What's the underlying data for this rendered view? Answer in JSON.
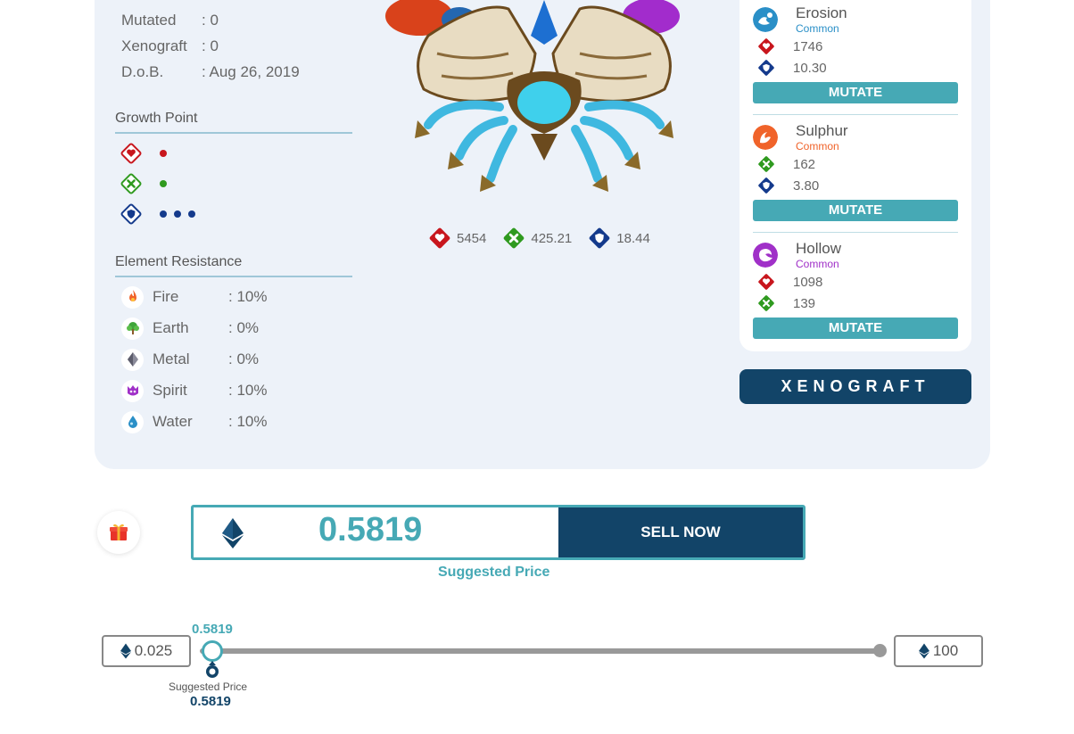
{
  "info": {
    "mutated": {
      "label": "Mutated",
      "value": ": 0"
    },
    "xenograft": {
      "label": "Xenograft",
      "value": ": 0"
    },
    "dob": {
      "label": "D.o.B.",
      "value": ": Aug 26, 2019"
    }
  },
  "growth_point": {
    "title": "Growth Point",
    "rows": [
      {
        "icon": "heart-icon",
        "color": "#c8161d",
        "dots": 1
      },
      {
        "icon": "attack-icon",
        "color": "#2f9a1f",
        "dots": 1
      },
      {
        "icon": "shield-icon",
        "color": "#143a8c",
        "dots": 3
      }
    ]
  },
  "element_resistance": {
    "title": "Element Resistance",
    "items": [
      {
        "name": "Fire",
        "value": ": 10%",
        "icon": "fire-icon"
      },
      {
        "name": "Earth",
        "value": ": 0%",
        "icon": "earth-icon"
      },
      {
        "name": "Metal",
        "value": ": 0%",
        "icon": "metal-icon"
      },
      {
        "name": "Spirit",
        "value": ": 10%",
        "icon": "spirit-icon"
      },
      {
        "name": "Water",
        "value": ": 10%",
        "icon": "water-icon"
      }
    ]
  },
  "stats": {
    "hp": "5454",
    "attack": "425.21",
    "defense": "18.44"
  },
  "mutations": [
    {
      "name": "Erosion",
      "rarity": "Common",
      "rarity_color": "#2a8fc7",
      "icon_color": "#2a8fc7",
      "stats": [
        {
          "type": "hp",
          "value": "1746"
        },
        {
          "type": "defense",
          "value": "10.30"
        }
      ],
      "button": "MUTATE"
    },
    {
      "name": "Sulphur",
      "rarity": "Common",
      "rarity_color": "#f0632a",
      "icon_color": "#f0632a",
      "stats": [
        {
          "type": "attack",
          "value": "162"
        },
        {
          "type": "defense",
          "value": "3.80"
        }
      ],
      "button": "MUTATE"
    },
    {
      "name": "Hollow",
      "rarity": "Common",
      "rarity_color": "#a030c8",
      "icon_color": "#a030c8",
      "stats": [
        {
          "type": "hp",
          "value": "1098"
        },
        {
          "type": "attack",
          "value": "139"
        }
      ],
      "button": "MUTATE"
    }
  ],
  "xenograft_button": "XENOGRAFT",
  "price": {
    "value": "0.5819",
    "sell_label": "SELL NOW",
    "suggested_label": "Suggested Price"
  },
  "slider": {
    "min": "0.025",
    "max": "100",
    "current": "0.5819",
    "marker_label": "Suggested Price",
    "marker_value": "0.5819"
  },
  "colors": {
    "accent": "#46a9b5",
    "navy": "#124468",
    "panel": "#edf2f9"
  }
}
